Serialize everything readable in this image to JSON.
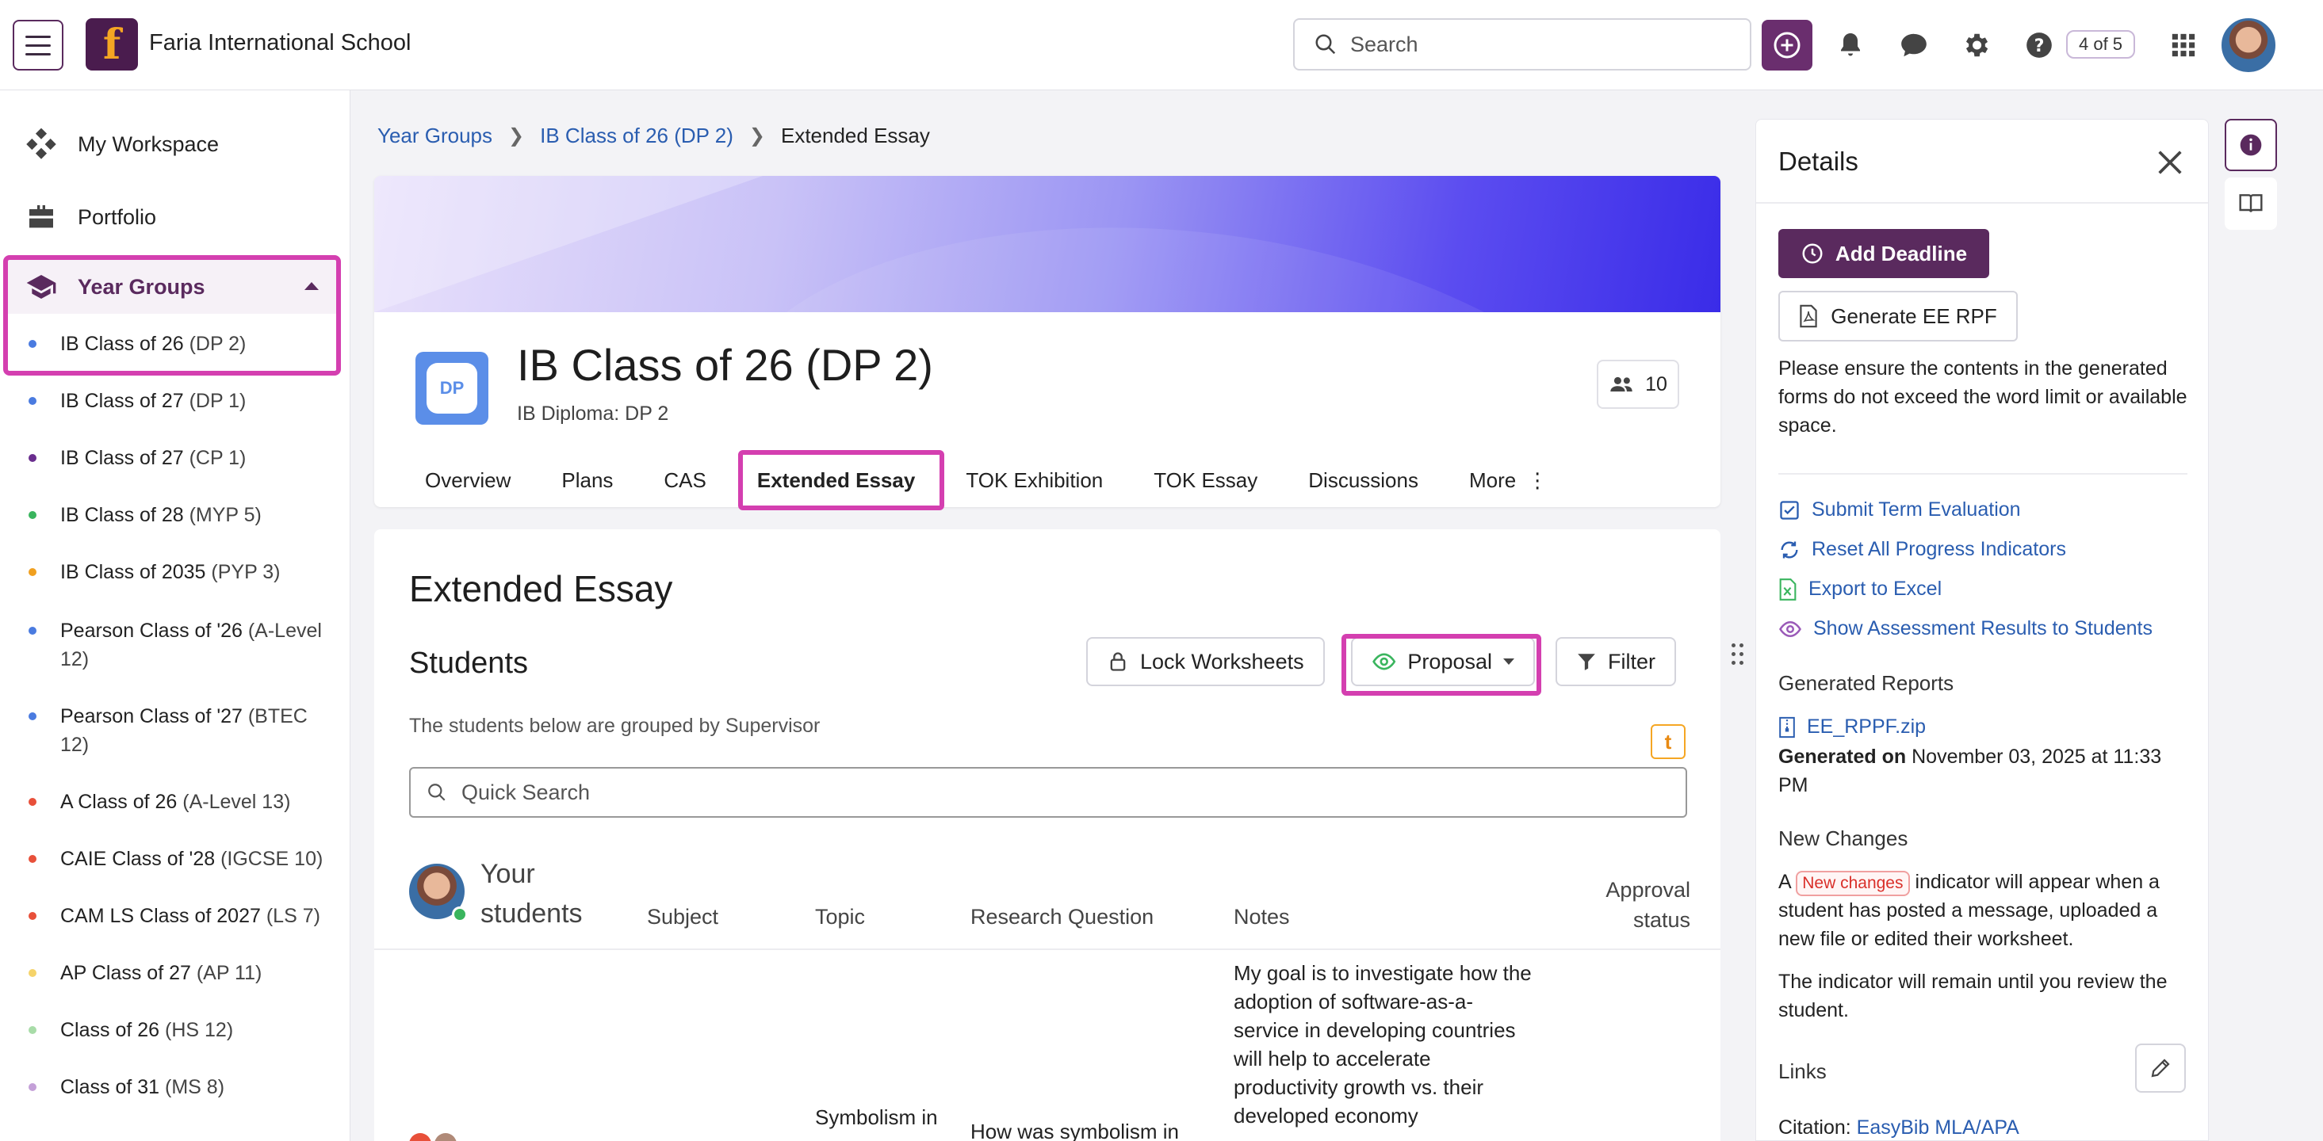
{
  "header": {
    "school_name": "Faria International School",
    "search_placeholder": "Search",
    "counter": "4 of 5"
  },
  "sidebar": {
    "my_workspace": "My Workspace",
    "portfolio": "Portfolio",
    "year_groups": "Year Groups",
    "groups": [
      {
        "name": "IB Class of 26",
        "tag": "(DP 2)",
        "color": "#4a7be0"
      },
      {
        "name": "IB Class of 27",
        "tag": "(DP 1)",
        "color": "#4a7be0"
      },
      {
        "name": "IB Class of 27",
        "tag": "(CP 1)",
        "color": "#6a2e8e"
      },
      {
        "name": "IB Class of 28",
        "tag": "(MYP 5)",
        "color": "#3ab55e"
      },
      {
        "name": "IB Class of 2035",
        "tag": "(PYP 3)",
        "color": "#f0a020"
      },
      {
        "name": "Pearson Class of '26",
        "tag": "(A-Level 12)",
        "color": "#4a7be0"
      },
      {
        "name": "Pearson Class of '27",
        "tag": "(BTEC 12)",
        "color": "#4a7be0"
      },
      {
        "name": "A Class of 26",
        "tag": "(A-Level 13)",
        "color": "#e8503a"
      },
      {
        "name": "CAIE Class of '28",
        "tag": "(IGCSE 10)",
        "color": "#e8503a"
      },
      {
        "name": "CAM LS Class of 2027",
        "tag": "(LS 7)",
        "color": "#e8503a"
      },
      {
        "name": "AP Class of 27",
        "tag": "(AP 11)",
        "color": "#f5d36a"
      },
      {
        "name": "Class of 26",
        "tag": "(HS 12)",
        "color": "#a8dca8"
      },
      {
        "name": "Class of 31",
        "tag": "(MS 8)",
        "color": "#c4a0d8"
      }
    ]
  },
  "breadcrumb": {
    "crumb1": "Year Groups",
    "crumb2": "IB Class of 26 (DP 2)",
    "current": "Extended Essay"
  },
  "class": {
    "badge": "DP",
    "title": "IB Class of 26 (DP 2)",
    "subtitle": "IB Diploma: DP 2",
    "member_count": "10",
    "tabs": [
      "Overview",
      "Plans",
      "CAS",
      "Extended Essay",
      "TOK Exhibition",
      "TOK Essay",
      "Discussions",
      "More"
    ]
  },
  "ee": {
    "title": "Extended Essay",
    "students_title": "Students",
    "lock_btn": "Lock Worksheets",
    "proposal_btn": "Proposal",
    "filter_btn": "Filter",
    "group_note": "The students below are grouped by Supervisor",
    "quick_search": "Quick Search",
    "your_students": "Your students",
    "columns": {
      "subject": "Subject",
      "topic": "Topic",
      "research_question": "Research Question",
      "notes": "Notes",
      "approval_status": "Approval status"
    },
    "row": {
      "notes": "My goal is to investigate how the adoption of software-as-a-service in developing countries will help to accelerate productivity growth vs. their developed economy",
      "topic": "Symbolism in",
      "research_question": "How was symbolism in"
    }
  },
  "details": {
    "title": "Details",
    "add_deadline": "Add Deadline",
    "generate_rpf": "Generate EE RPF",
    "ensure_text": "Please ensure the contents in the generated forms do not exceed the word limit or available space.",
    "actions": {
      "submit": "Submit Term Evaluation",
      "reset": "Reset All Progress Indicators",
      "export": "Export to Excel",
      "show": "Show Assessment Results to Students"
    },
    "generated_reports": "Generated Reports",
    "report_file": "EE_RPPF.zip",
    "generated_on_label": "Generated on",
    "generated_on_value": "November 03, 2025 at 11:33 PM",
    "new_changes_heading": "New Changes",
    "nc_prefix": "A",
    "nc_badge": "New changes",
    "nc_suffix": "indicator will appear when a student has posted a message, uploaded a new file or edited their worksheet.",
    "nc_remain": "The indicator will remain until you review the student.",
    "links_heading": "Links",
    "citation_label": "Citation:",
    "citation_link": "EasyBib MLA/APA"
  }
}
